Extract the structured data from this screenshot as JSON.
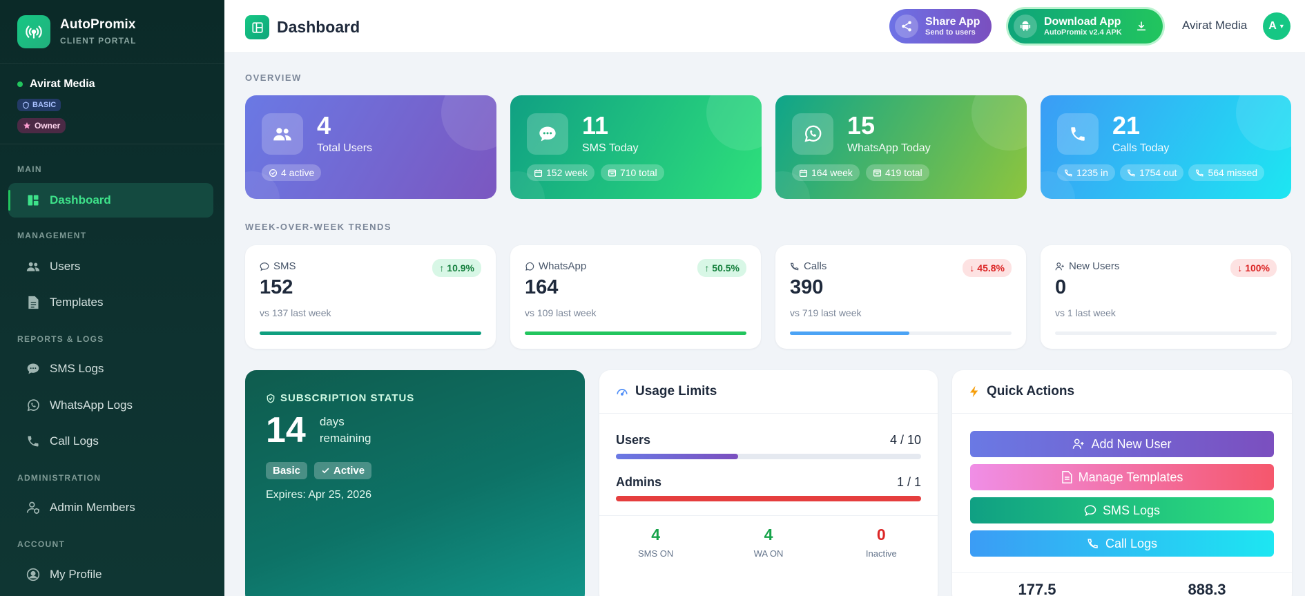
{
  "brand": {
    "name": "AutoPromix",
    "subtitle": "CLIENT PORTAL"
  },
  "org": {
    "name": "Avirat Media",
    "plan": "BASIC",
    "role": "Owner"
  },
  "nav": {
    "sections": {
      "main": "MAIN",
      "management": "MANAGEMENT",
      "reports": "REPORTS & LOGS",
      "admin": "ADMINISTRATION",
      "account": "ACCOUNT"
    },
    "items": {
      "dashboard": "Dashboard",
      "users": "Users",
      "templates": "Templates",
      "sms_logs": "SMS Logs",
      "whatsapp_logs": "WhatsApp Logs",
      "call_logs": "Call Logs",
      "admin_members": "Admin Members",
      "my_profile": "My Profile"
    }
  },
  "header": {
    "title": "Dashboard",
    "share": {
      "label": "Share App",
      "sub": "Send to users"
    },
    "download": {
      "label": "Download App",
      "sub": "AutoPromix v2.4 APK"
    },
    "user": "Avirat Media",
    "avatar_letter": "A"
  },
  "overview": {
    "label": "OVERVIEW",
    "cards": [
      {
        "value": "4",
        "label": "Total Users",
        "pills": [
          "4 active"
        ]
      },
      {
        "value": "11",
        "label": "SMS Today",
        "pills": [
          "152 week",
          "710 total"
        ]
      },
      {
        "value": "15",
        "label": "WhatsApp Today",
        "pills": [
          "164 week",
          "419 total"
        ]
      },
      {
        "value": "21",
        "label": "Calls Today",
        "pills": [
          "1235 in",
          "1754 out",
          "564 missed"
        ]
      }
    ]
  },
  "trends": {
    "label": "WEEK-OVER-WEEK TRENDS",
    "cards": [
      {
        "name": "SMS",
        "value": "152",
        "change": "10.9%",
        "direction": "up",
        "compare": "vs 137 last week",
        "progress": 1.0,
        "color": "#0f9f7f"
      },
      {
        "name": "WhatsApp",
        "value": "164",
        "change": "50.5%",
        "direction": "up",
        "compare": "vs 109 last week",
        "progress": 1.0,
        "color": "#22c55e"
      },
      {
        "name": "Calls",
        "value": "390",
        "change": "45.8%",
        "direction": "down",
        "compare": "vs 719 last week",
        "progress": 0.54,
        "color": "#4ba3f5"
      },
      {
        "name": "New Users",
        "value": "0",
        "change": "100%",
        "direction": "down",
        "compare": "vs 1 last week",
        "progress": 0.0,
        "color": "#94a3b8"
      }
    ]
  },
  "subscription": {
    "heading": "SUBSCRIPTION STATUS",
    "days": "14",
    "days_label_1": "days",
    "days_label_2": "remaining",
    "plan": "Basic",
    "status": "Active",
    "expires": "Expires: Apr 25, 2026"
  },
  "usage": {
    "title": "Usage Limits",
    "limits": [
      {
        "label": "Users",
        "value": "4 / 10",
        "fraction": 0.4
      },
      {
        "label": "Admins",
        "value": "1 / 1",
        "fraction": 1.0
      }
    ],
    "stats": [
      {
        "value": "4",
        "label": "SMS ON",
        "color": "#16a34a"
      },
      {
        "value": "4",
        "label": "WA ON",
        "color": "#16a34a"
      },
      {
        "value": "0",
        "label": "Inactive",
        "color": "#dc2626"
      }
    ]
  },
  "quick_actions": {
    "title": "Quick Actions",
    "buttons": [
      "Add New User",
      "Manage Templates",
      "SMS Logs",
      "Call Logs"
    ],
    "footer": [
      "177.5",
      "888.3"
    ]
  },
  "colors": {
    "accent": "#16c784",
    "sidebar_bg": "#0e3230"
  }
}
